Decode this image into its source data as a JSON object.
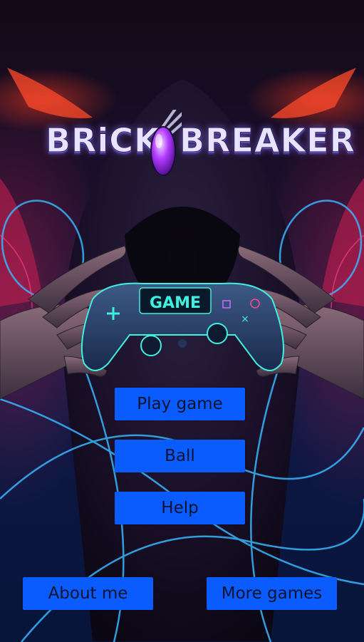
{
  "logo": {
    "text_left": "BRiCK",
    "text_right": "BREAKER"
  },
  "controller": {
    "screen_text": "GAME"
  },
  "menu": {
    "play_label": "Play game",
    "ball_label": "Ball",
    "help_label": "Help"
  },
  "footer": {
    "about_label": "About me",
    "more_label": "More games"
  },
  "colors": {
    "button_bg": "#0a5cff",
    "button_text": "#0b1330",
    "neon_blue": "#38b8ff",
    "neon_cyan": "#3ef0e0",
    "hood_glow": "#ff3a2a"
  }
}
